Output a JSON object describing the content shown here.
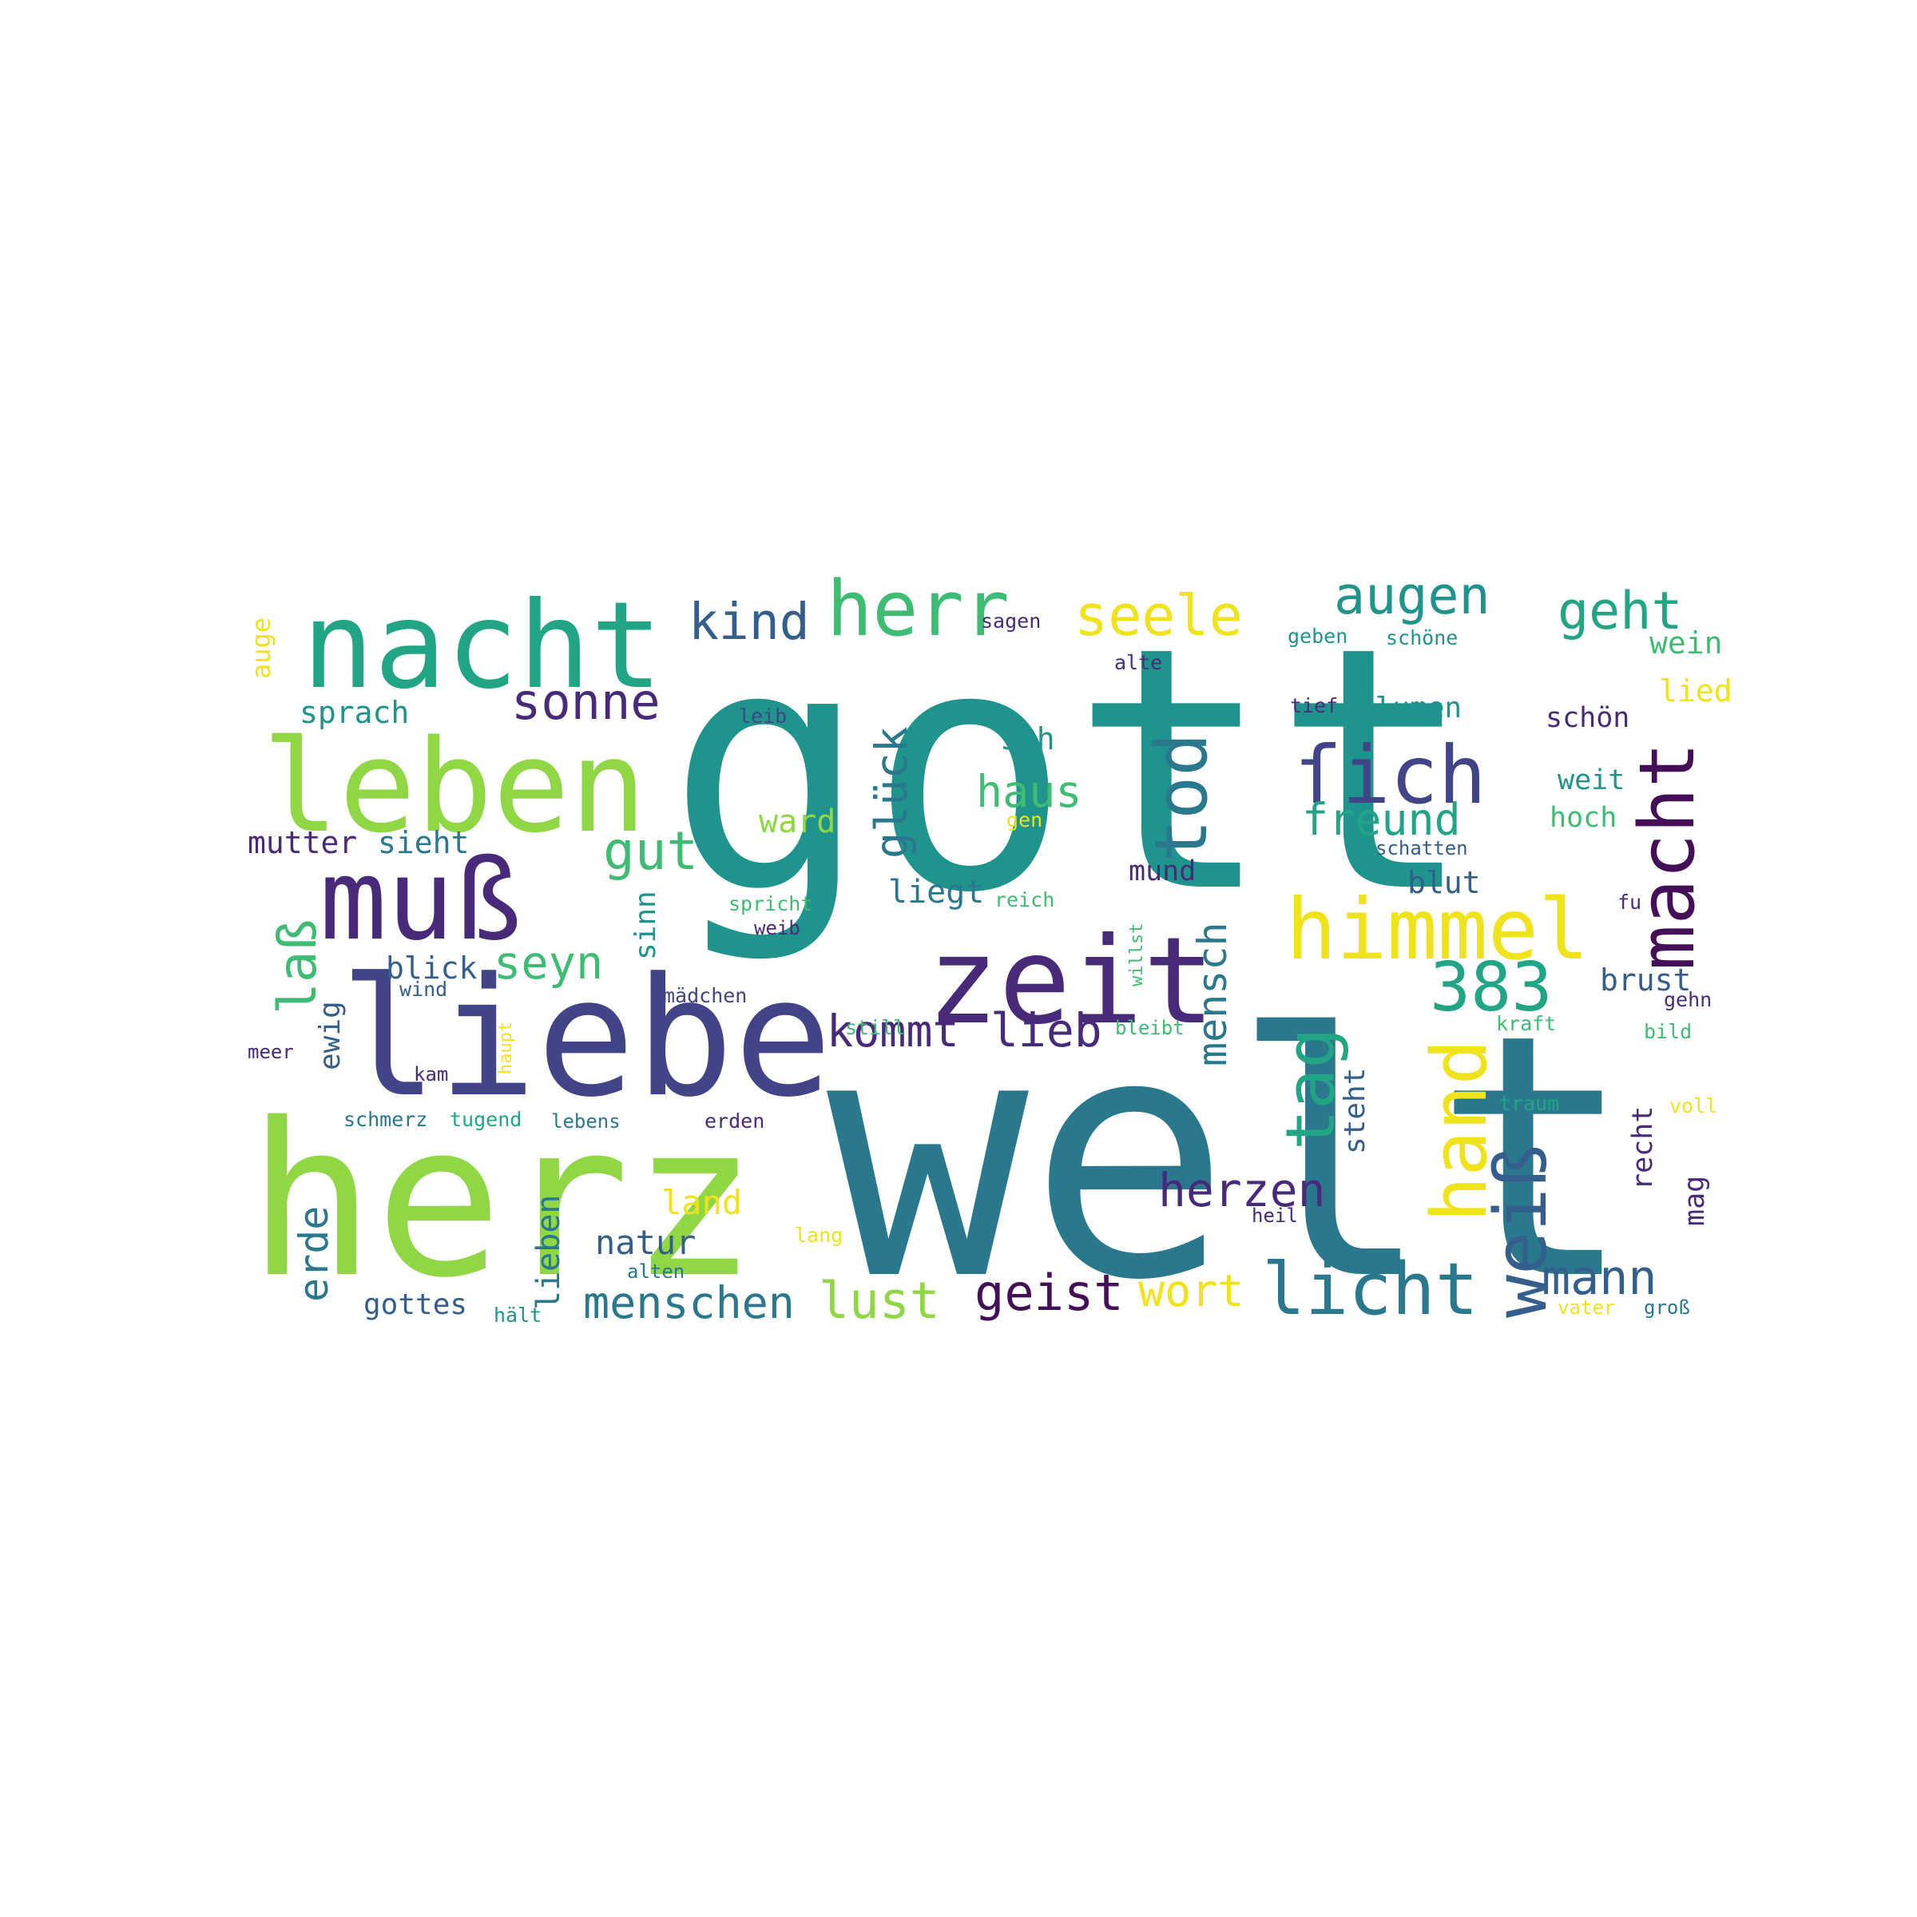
{
  "palette": {
    "yellow": "#f0e21b",
    "lightgreen": "#8fd744",
    "green": "#3fbc73",
    "teal": "#21a585",
    "cyan": "#1f948c",
    "steel": "#2a788e",
    "blue": "#345f8d",
    "indigo": "#414487",
    "purple": "#472b7a",
    "darkpurple": "#440f57"
  },
  "words": [
    {
      "text": "gott",
      "color": "cyan"
    },
    {
      "text": "welt",
      "color": "steel"
    },
    {
      "text": "herz",
      "color": "lightgreen"
    },
    {
      "text": "liebe",
      "color": "indigo"
    },
    {
      "text": "leben",
      "color": "lightgreen"
    },
    {
      "text": "nacht",
      "color": "teal"
    },
    {
      "text": "zeit",
      "color": "purple"
    },
    {
      "text": "muß",
      "color": "purple"
    },
    {
      "text": "herr",
      "color": "green"
    },
    {
      "text": "himmel",
      "color": "yellow"
    },
    {
      "text": "licht",
      "color": "steel"
    },
    {
      "text": "ſich",
      "color": "indigo"
    },
    {
      "text": "macht",
      "color": "darkpurple"
    },
    {
      "text": "tod",
      "color": "steel"
    },
    {
      "text": "hand",
      "color": "yellow"
    },
    {
      "text": "weiß",
      "color": "blue"
    },
    {
      "text": "383",
      "color": "teal"
    },
    {
      "text": "tag",
      "color": "teal"
    },
    {
      "text": "seele",
      "color": "yellow"
    },
    {
      "text": "augen",
      "color": "cyan"
    },
    {
      "text": "geht",
      "color": "teal"
    },
    {
      "text": "kind",
      "color": "blue"
    },
    {
      "text": "sonne",
      "color": "purple"
    },
    {
      "text": "gut",
      "color": "green"
    },
    {
      "text": "laß",
      "color": "green"
    },
    {
      "text": "geist",
      "color": "darkpurple"
    },
    {
      "text": "mann",
      "color": "blue"
    },
    {
      "text": "lust",
      "color": "lightgreen"
    },
    {
      "text": "menschen",
      "color": "steel"
    },
    {
      "text": "wort",
      "color": "yellow"
    },
    {
      "text": "herzen",
      "color": "purple"
    },
    {
      "text": "freund",
      "color": "teal"
    },
    {
      "text": "kommt",
      "color": "purple"
    },
    {
      "text": "lieb",
      "color": "purple"
    },
    {
      "text": "seyn",
      "color": "green"
    },
    {
      "text": "haus",
      "color": "green"
    },
    {
      "text": "glück",
      "color": "steel"
    },
    {
      "text": "mensch",
      "color": "steel"
    },
    {
      "text": "erde",
      "color": "steel"
    },
    {
      "text": "sprach",
      "color": "cyan"
    },
    {
      "text": "sah",
      "color": "cyan"
    },
    {
      "text": "ward",
      "color": "lightgreen"
    },
    {
      "text": "mutter",
      "color": "purple"
    },
    {
      "text": "sieht",
      "color": "steel"
    },
    {
      "text": "mund",
      "color": "purple"
    },
    {
      "text": "liegt",
      "color": "steel"
    },
    {
      "text": "blumen",
      "color": "cyan"
    },
    {
      "text": "schön",
      "color": "purple"
    },
    {
      "text": "weit",
      "color": "cyan"
    },
    {
      "text": "hoch",
      "color": "green"
    },
    {
      "text": "blut",
      "color": "blue"
    },
    {
      "text": "brust",
      "color": "blue"
    },
    {
      "text": "natur",
      "color": "blue"
    },
    {
      "text": "land",
      "color": "yellow"
    },
    {
      "text": "gottes",
      "color": "blue"
    },
    {
      "text": "lieben",
      "color": "steel"
    },
    {
      "text": "sinn",
      "color": "cyan"
    },
    {
      "text": "blick",
      "color": "blue"
    },
    {
      "text": "ewig",
      "color": "blue"
    },
    {
      "text": "steht",
      "color": "blue"
    },
    {
      "text": "recht",
      "color": "purple"
    },
    {
      "text": "mag",
      "color": "purple"
    },
    {
      "text": "wein",
      "color": "green"
    },
    {
      "text": "lied",
      "color": "yellow"
    },
    {
      "text": "auge",
      "color": "yellow"
    },
    {
      "text": "sagen",
      "color": "purple"
    },
    {
      "text": "alte",
      "color": "purple"
    },
    {
      "text": "geben",
      "color": "cyan"
    },
    {
      "text": "schöne",
      "color": "cyan"
    },
    {
      "text": "tief",
      "color": "purple"
    },
    {
      "text": "leib",
      "color": "indigo"
    },
    {
      "text": "gen",
      "color": "yellow"
    },
    {
      "text": "schatten",
      "color": "blue"
    },
    {
      "text": "spricht",
      "color": "green"
    },
    {
      "text": "weib",
      "color": "purple"
    },
    {
      "text": "reich",
      "color": "green"
    },
    {
      "text": "fu",
      "color": "purple"
    },
    {
      "text": "willst",
      "color": "green"
    },
    {
      "text": "still",
      "color": "green"
    },
    {
      "text": "mädchen",
      "color": "indigo"
    },
    {
      "text": "wind",
      "color": "blue"
    },
    {
      "text": "meer",
      "color": "purple"
    },
    {
      "text": "haupt",
      "color": "yellow"
    },
    {
      "text": "kam",
      "color": "purple"
    },
    {
      "text": "bleibt",
      "color": "green"
    },
    {
      "text": "kraft",
      "color": "green"
    },
    {
      "text": "gehn",
      "color": "purple"
    },
    {
      "text": "bild",
      "color": "green"
    },
    {
      "text": "schmerz",
      "color": "steel"
    },
    {
      "text": "tugend",
      "color": "teal"
    },
    {
      "text": "lebens",
      "color": "steel"
    },
    {
      "text": "erden",
      "color": "purple"
    },
    {
      "text": "traum",
      "color": "teal"
    },
    {
      "text": "voll",
      "color": "yellow"
    },
    {
      "text": "heil",
      "color": "purple"
    },
    {
      "text": "lang",
      "color": "yellow"
    },
    {
      "text": "alten",
      "color": "steel"
    },
    {
      "text": "hält",
      "color": "cyan"
    },
    {
      "text": "vater",
      "color": "yellow"
    },
    {
      "text": "groß",
      "color": "steel"
    }
  ]
}
